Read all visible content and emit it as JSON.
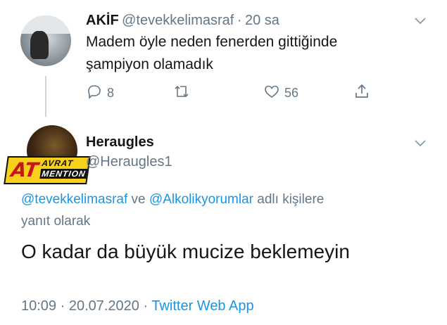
{
  "tweet1": {
    "name": "AKİF",
    "handle": "@tevekkelimasraf",
    "separator": "·",
    "time": "20 sa",
    "text_line1": "Madem öyle neden fenerden gittiğinde",
    "text_line2": "şampiyon olamadık",
    "replies": "8",
    "likes": "56"
  },
  "tweet2": {
    "name": "Heraugles",
    "handle": "@Heraugles1",
    "badge": {
      "at": "AT",
      "top": "AVRAT",
      "bottom": "MENTION"
    },
    "reply_to": {
      "mention1": "@tevekkelimasraf",
      "joiner": " ve ",
      "mention2": "@Alkolikyorumlar",
      "suffix_line1": " adlı kişilere",
      "suffix_line2": "yanıt olarak"
    },
    "text": "O kadar da büyük mucize beklemeyin",
    "timestamp": "10:09 · 20.07.2020 · ",
    "source": "Twitter Web App"
  },
  "colors": {
    "link": "#1b95e0",
    "muted": "#657786",
    "text": "#14171a"
  },
  "icons": [
    "chevron-down-icon",
    "reply-icon",
    "retweet-icon",
    "like-icon",
    "share-icon"
  ]
}
